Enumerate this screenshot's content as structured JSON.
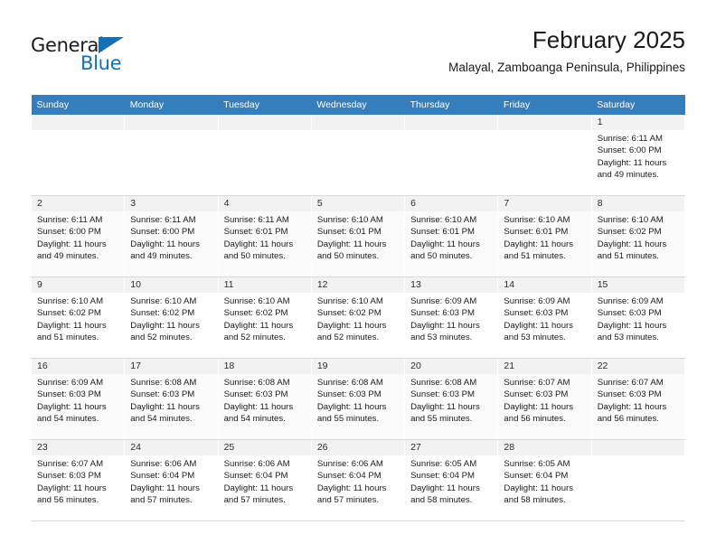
{
  "logo": {
    "word1": "General",
    "word2": "Blue",
    "triangle_color": "#1470b8"
  },
  "header": {
    "title": "February 2025",
    "subtitle": "Malayal, Zamboanga Peninsula, Philippines"
  },
  "theme": {
    "header_bg": "#357ebd",
    "header_text": "#ffffff",
    "daynum_bg": "#f2f2f2",
    "row_alt_bg": "#fbfbfb",
    "grid_line": "#d9d9d9"
  },
  "weekdays": [
    "Sunday",
    "Monday",
    "Tuesday",
    "Wednesday",
    "Thursday",
    "Friday",
    "Saturday"
  ],
  "labels": {
    "sunrise_prefix": "Sunrise:",
    "sunset_prefix": "Sunset:",
    "daylight_prefix": "Daylight:"
  },
  "weeks": [
    [
      {
        "day": "",
        "empty": true
      },
      {
        "day": "",
        "empty": true
      },
      {
        "day": "",
        "empty": true
      },
      {
        "day": "",
        "empty": true
      },
      {
        "day": "",
        "empty": true
      },
      {
        "day": "",
        "empty": true
      },
      {
        "day": "1",
        "sunrise": "Sunrise: 6:11 AM",
        "sunset": "Sunset: 6:00 PM",
        "daylight_l1": "Daylight: 11 hours",
        "daylight_l2": "and 49 minutes."
      }
    ],
    [
      {
        "day": "2",
        "sunrise": "Sunrise: 6:11 AM",
        "sunset": "Sunset: 6:00 PM",
        "daylight_l1": "Daylight: 11 hours",
        "daylight_l2": "and 49 minutes."
      },
      {
        "day": "3",
        "sunrise": "Sunrise: 6:11 AM",
        "sunset": "Sunset: 6:00 PM",
        "daylight_l1": "Daylight: 11 hours",
        "daylight_l2": "and 49 minutes."
      },
      {
        "day": "4",
        "sunrise": "Sunrise: 6:11 AM",
        "sunset": "Sunset: 6:01 PM",
        "daylight_l1": "Daylight: 11 hours",
        "daylight_l2": "and 50 minutes."
      },
      {
        "day": "5",
        "sunrise": "Sunrise: 6:10 AM",
        "sunset": "Sunset: 6:01 PM",
        "daylight_l1": "Daylight: 11 hours",
        "daylight_l2": "and 50 minutes."
      },
      {
        "day": "6",
        "sunrise": "Sunrise: 6:10 AM",
        "sunset": "Sunset: 6:01 PM",
        "daylight_l1": "Daylight: 11 hours",
        "daylight_l2": "and 50 minutes."
      },
      {
        "day": "7",
        "sunrise": "Sunrise: 6:10 AM",
        "sunset": "Sunset: 6:01 PM",
        "daylight_l1": "Daylight: 11 hours",
        "daylight_l2": "and 51 minutes."
      },
      {
        "day": "8",
        "sunrise": "Sunrise: 6:10 AM",
        "sunset": "Sunset: 6:02 PM",
        "daylight_l1": "Daylight: 11 hours",
        "daylight_l2": "and 51 minutes."
      }
    ],
    [
      {
        "day": "9",
        "sunrise": "Sunrise: 6:10 AM",
        "sunset": "Sunset: 6:02 PM",
        "daylight_l1": "Daylight: 11 hours",
        "daylight_l2": "and 51 minutes."
      },
      {
        "day": "10",
        "sunrise": "Sunrise: 6:10 AM",
        "sunset": "Sunset: 6:02 PM",
        "daylight_l1": "Daylight: 11 hours",
        "daylight_l2": "and 52 minutes."
      },
      {
        "day": "11",
        "sunrise": "Sunrise: 6:10 AM",
        "sunset": "Sunset: 6:02 PM",
        "daylight_l1": "Daylight: 11 hours",
        "daylight_l2": "and 52 minutes."
      },
      {
        "day": "12",
        "sunrise": "Sunrise: 6:10 AM",
        "sunset": "Sunset: 6:02 PM",
        "daylight_l1": "Daylight: 11 hours",
        "daylight_l2": "and 52 minutes."
      },
      {
        "day": "13",
        "sunrise": "Sunrise: 6:09 AM",
        "sunset": "Sunset: 6:03 PM",
        "daylight_l1": "Daylight: 11 hours",
        "daylight_l2": "and 53 minutes."
      },
      {
        "day": "14",
        "sunrise": "Sunrise: 6:09 AM",
        "sunset": "Sunset: 6:03 PM",
        "daylight_l1": "Daylight: 11 hours",
        "daylight_l2": "and 53 minutes."
      },
      {
        "day": "15",
        "sunrise": "Sunrise: 6:09 AM",
        "sunset": "Sunset: 6:03 PM",
        "daylight_l1": "Daylight: 11 hours",
        "daylight_l2": "and 53 minutes."
      }
    ],
    [
      {
        "day": "16",
        "sunrise": "Sunrise: 6:09 AM",
        "sunset": "Sunset: 6:03 PM",
        "daylight_l1": "Daylight: 11 hours",
        "daylight_l2": "and 54 minutes."
      },
      {
        "day": "17",
        "sunrise": "Sunrise: 6:08 AM",
        "sunset": "Sunset: 6:03 PM",
        "daylight_l1": "Daylight: 11 hours",
        "daylight_l2": "and 54 minutes."
      },
      {
        "day": "18",
        "sunrise": "Sunrise: 6:08 AM",
        "sunset": "Sunset: 6:03 PM",
        "daylight_l1": "Daylight: 11 hours",
        "daylight_l2": "and 54 minutes."
      },
      {
        "day": "19",
        "sunrise": "Sunrise: 6:08 AM",
        "sunset": "Sunset: 6:03 PM",
        "daylight_l1": "Daylight: 11 hours",
        "daylight_l2": "and 55 minutes."
      },
      {
        "day": "20",
        "sunrise": "Sunrise: 6:08 AM",
        "sunset": "Sunset: 6:03 PM",
        "daylight_l1": "Daylight: 11 hours",
        "daylight_l2": "and 55 minutes."
      },
      {
        "day": "21",
        "sunrise": "Sunrise: 6:07 AM",
        "sunset": "Sunset: 6:03 PM",
        "daylight_l1": "Daylight: 11 hours",
        "daylight_l2": "and 56 minutes."
      },
      {
        "day": "22",
        "sunrise": "Sunrise: 6:07 AM",
        "sunset": "Sunset: 6:03 PM",
        "daylight_l1": "Daylight: 11 hours",
        "daylight_l2": "and 56 minutes."
      }
    ],
    [
      {
        "day": "23",
        "sunrise": "Sunrise: 6:07 AM",
        "sunset": "Sunset: 6:03 PM",
        "daylight_l1": "Daylight: 11 hours",
        "daylight_l2": "and 56 minutes."
      },
      {
        "day": "24",
        "sunrise": "Sunrise: 6:06 AM",
        "sunset": "Sunset: 6:04 PM",
        "daylight_l1": "Daylight: 11 hours",
        "daylight_l2": "and 57 minutes."
      },
      {
        "day": "25",
        "sunrise": "Sunrise: 6:06 AM",
        "sunset": "Sunset: 6:04 PM",
        "daylight_l1": "Daylight: 11 hours",
        "daylight_l2": "and 57 minutes."
      },
      {
        "day": "26",
        "sunrise": "Sunrise: 6:06 AM",
        "sunset": "Sunset: 6:04 PM",
        "daylight_l1": "Daylight: 11 hours",
        "daylight_l2": "and 57 minutes."
      },
      {
        "day": "27",
        "sunrise": "Sunrise: 6:05 AM",
        "sunset": "Sunset: 6:04 PM",
        "daylight_l1": "Daylight: 11 hours",
        "daylight_l2": "and 58 minutes."
      },
      {
        "day": "28",
        "sunrise": "Sunrise: 6:05 AM",
        "sunset": "Sunset: 6:04 PM",
        "daylight_l1": "Daylight: 11 hours",
        "daylight_l2": "and 58 minutes."
      },
      {
        "day": "",
        "empty": true
      }
    ]
  ]
}
